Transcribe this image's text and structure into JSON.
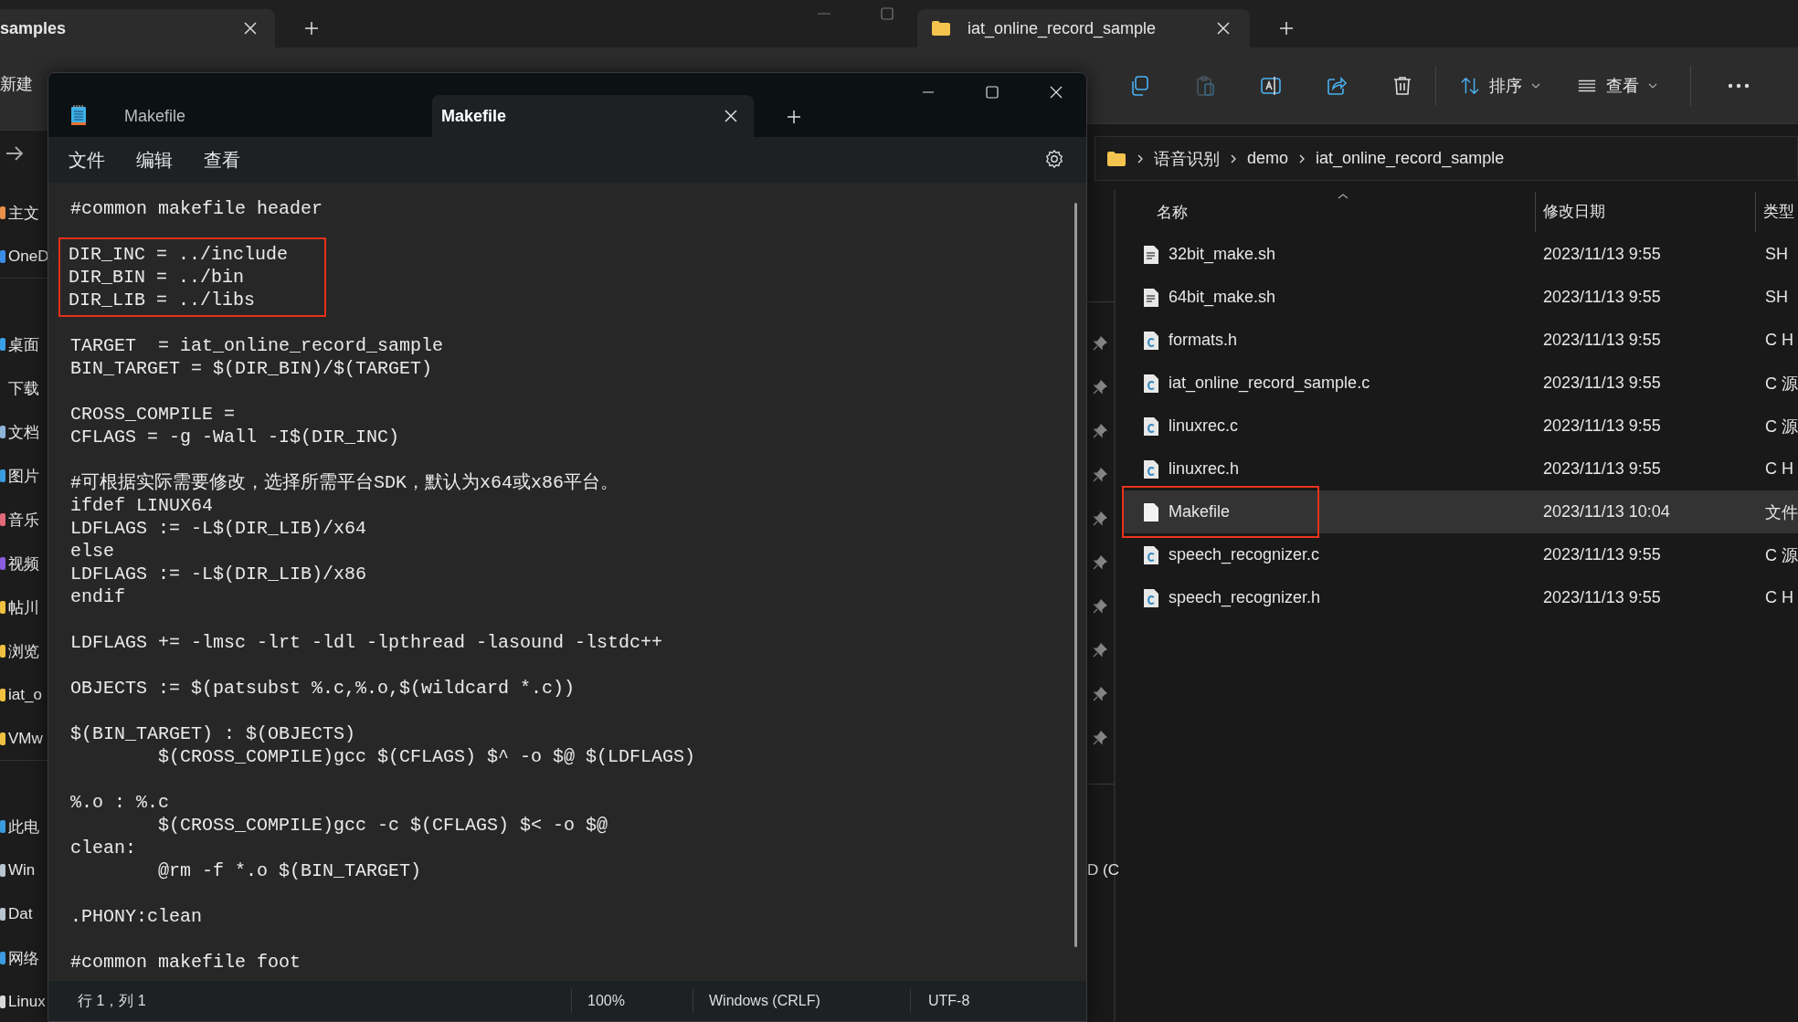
{
  "left_explorer": {
    "tab_title": "samples",
    "new_button": "新建",
    "sidebar_items": [
      {
        "label": "主文",
        "color": "#e8904a"
      },
      {
        "label": "OneD",
        "color": "#3b8ee8"
      },
      {
        "label": "桌面",
        "color": "#3aa0e8"
      },
      {
        "label": "下载"
      },
      {
        "label": "文档",
        "color": "#8fb4d8"
      },
      {
        "label": "图片",
        "color": "#3a9be0"
      },
      {
        "label": "音乐",
        "color": "#e06a7a"
      },
      {
        "label": "视频",
        "color": "#8a5ce0"
      },
      {
        "label": "帖川",
        "color": "#f0c040"
      },
      {
        "label": "浏览",
        "color": "#f0c040"
      },
      {
        "label": "iat_o",
        "color": "#f0c040"
      },
      {
        "label": "VMw",
        "color": "#f0c040"
      },
      {
        "label": "此电",
        "color": "#3a9be0"
      },
      {
        "label": "Win",
        "color": "#b8c4d0"
      },
      {
        "label": "Dat",
        "color": "#b8c4d0"
      },
      {
        "label": "网络",
        "color": "#3a9be0"
      },
      {
        "label": "Linux",
        "color": "#d8d8d8"
      }
    ]
  },
  "right_explorer": {
    "tab_title": "iat_online_record_sample",
    "sort_button": "排序",
    "view_button": "查看",
    "nav_fragment": "D (C",
    "breadcrumb": [
      "语音识别",
      "demo",
      "iat_online_record_sample"
    ],
    "columns": [
      "名称",
      "修改日期",
      "类型"
    ],
    "files": [
      {
        "name": "32bit_make.sh",
        "date": "2023/11/13 9:55",
        "type": "SH",
        "kind": "script",
        "selected": false,
        "highlighted": false
      },
      {
        "name": "64bit_make.sh",
        "date": "2023/11/13 9:55",
        "type": "SH",
        "kind": "script",
        "selected": false,
        "highlighted": false
      },
      {
        "name": "formats.h",
        "date": "2023/11/13 9:55",
        "type": "C H",
        "kind": "c",
        "selected": false,
        "highlighted": false
      },
      {
        "name": "iat_online_record_sample.c",
        "date": "2023/11/13 9:55",
        "type": "C 源",
        "kind": "c",
        "selected": false,
        "highlighted": false
      },
      {
        "name": "linuxrec.c",
        "date": "2023/11/13 9:55",
        "type": "C 源",
        "kind": "c",
        "selected": false,
        "highlighted": false
      },
      {
        "name": "linuxrec.h",
        "date": "2023/11/13 9:55",
        "type": "C H",
        "kind": "c",
        "selected": false,
        "highlighted": false
      },
      {
        "name": "Makefile",
        "date": "2023/11/13 10:04",
        "type": "文件",
        "kind": "plain",
        "selected": true,
        "highlighted": true
      },
      {
        "name": "speech_recognizer.c",
        "date": "2023/11/13 9:55",
        "type": "C 源",
        "kind": "c",
        "selected": false,
        "highlighted": false
      },
      {
        "name": "speech_recognizer.h",
        "date": "2023/11/13 9:55",
        "type": "C H",
        "kind": "c",
        "selected": false,
        "highlighted": false
      }
    ]
  },
  "notepad": {
    "tabs": [
      {
        "label": "Makefile",
        "selected": false
      },
      {
        "label": "Makefile",
        "selected": true
      }
    ],
    "menu": [
      "文件",
      "编辑",
      "查看"
    ],
    "code_blocks": [
      {
        "lines": [
          "#common makefile header"
        ],
        "highlighted": false
      },
      {
        "lines": [
          "DIR_INC = ../include",
          "DIR_BIN = ../bin",
          "DIR_LIB = ../libs"
        ],
        "highlighted": true
      },
      {
        "lines": [
          "TARGET  = iat_online_record_sample",
          "BIN_TARGET = $(DIR_BIN)/$(TARGET)"
        ],
        "highlighted": false
      },
      {
        "lines": [
          "CROSS_COMPILE =",
          "CFLAGS = -g -Wall -I$(DIR_INC)"
        ],
        "highlighted": false
      },
      {
        "lines": [
          "#可根据实际需要修改，选择所需平台SDK，默认为x64或x86平台。",
          "ifdef LINUX64",
          "LDFLAGS := -L$(DIR_LIB)/x64",
          "else",
          "LDFLAGS := -L$(DIR_LIB)/x86",
          "endif"
        ],
        "highlighted": false
      },
      {
        "lines": [
          "LDFLAGS += -lmsc -lrt -ldl -lpthread -lasound -lstdc++"
        ],
        "highlighted": false
      },
      {
        "lines": [
          "OBJECTS := $(patsubst %.c,%.o,$(wildcard *.c))"
        ],
        "highlighted": false
      },
      {
        "lines": [
          "$(BIN_TARGET) : $(OBJECTS)",
          "\t$(CROSS_COMPILE)gcc $(CFLAGS) $^ -o $@ $(LDFLAGS)"
        ],
        "highlighted": false
      },
      {
        "lines": [
          "%.o : %.c",
          "\t$(CROSS_COMPILE)gcc -c $(CFLAGS) $< -o $@",
          "clean:",
          "\t@rm -f *.o $(BIN_TARGET)"
        ],
        "highlighted": false
      },
      {
        "lines": [
          ".PHONY:clean"
        ],
        "highlighted": false
      },
      {
        "lines": [
          "#common makefile foot"
        ],
        "highlighted": false
      }
    ],
    "status": {
      "position": "行 1，列 1",
      "zoom": "100%",
      "line_ending": "Windows (CRLF)",
      "encoding": "UTF-8"
    }
  }
}
